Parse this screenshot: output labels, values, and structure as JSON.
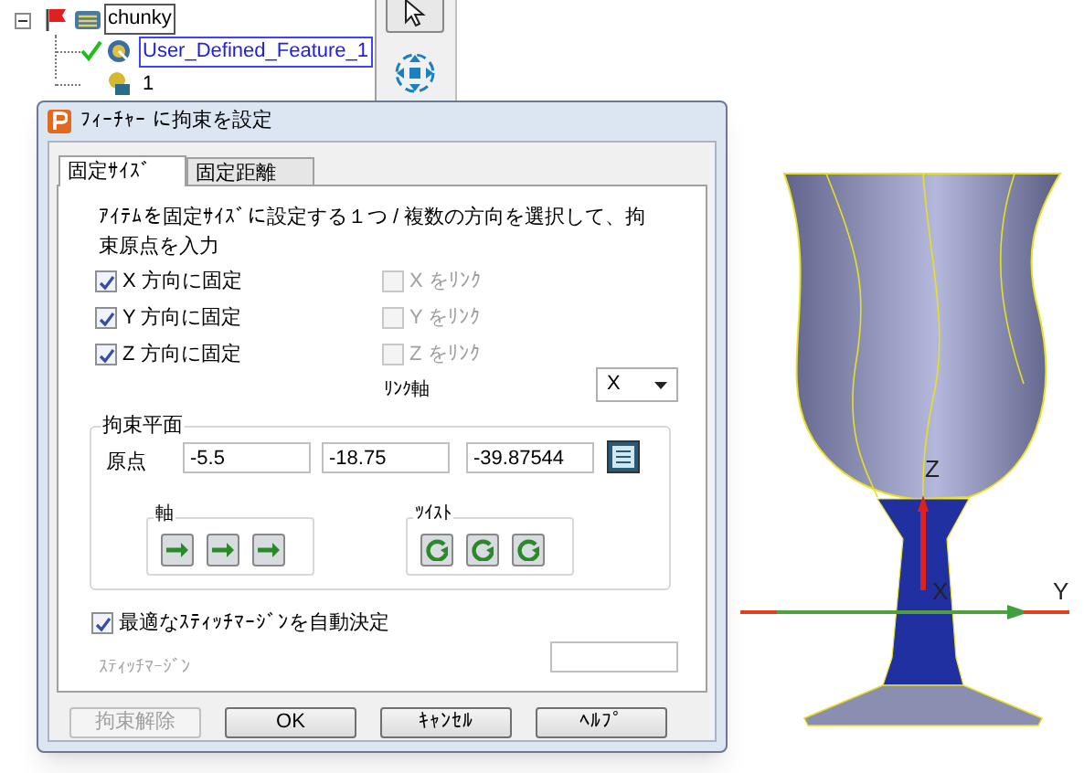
{
  "tree": {
    "label": "chunky",
    "expanded": true,
    "children": [
      {
        "label": "User_Defined_Feature_1",
        "checked": true,
        "selected": true
      },
      {
        "label": "1",
        "checked": false,
        "selected": false
      }
    ]
  },
  "dialog": {
    "title": "ﾌｨｰﾁｬｰ に拘束を設定",
    "tabs": [
      {
        "label": "固定ｻｲｽﾞ",
        "selected": true
      },
      {
        "label": "固定距離",
        "selected": false
      }
    ],
    "description": "ｱｲﾃﾑを固定ｻｲｽﾞに設定する１つ / 複数の方向を選択して、拘束原点を入力",
    "fix_checkboxes": [
      {
        "label": "X 方向に固定",
        "checked": true
      },
      {
        "label": "Y 方向に固定",
        "checked": true
      },
      {
        "label": "Z 方向に固定",
        "checked": true
      }
    ],
    "link_checkboxes": [
      {
        "label": "X をﾘﾝｸ",
        "checked": false,
        "disabled": true
      },
      {
        "label": "Y をﾘﾝｸ",
        "checked": false,
        "disabled": true
      },
      {
        "label": "Z をﾘﾝｸ",
        "checked": false,
        "disabled": true
      }
    ],
    "link_axis": {
      "label": "ﾘﾝｸ軸",
      "value": "X"
    },
    "constraint_plane": {
      "title": "拘束平面",
      "origin_label": "原点",
      "origin": [
        "-5.5",
        "-18.75",
        "-39.87544"
      ],
      "axis_group": {
        "title": "軸"
      },
      "twist_group": {
        "title": "ﾂｲｽﾄ"
      }
    },
    "auto_margin": {
      "label": "最適なｽﾃｨｯﾁﾏｰｼﾞﾝを自動決定",
      "checked": true
    },
    "stitch_margin": {
      "label": "ｽﾃｨｯﾁﾏｰｼﾞﾝ",
      "disabled": true
    },
    "buttons": [
      {
        "label": "拘束解除",
        "disabled": true
      },
      {
        "label": "OK",
        "disabled": false
      },
      {
        "label": "ｷｬﾝｾﾙ",
        "disabled": false
      },
      {
        "label": "ﾍﾙﾌﾟ",
        "disabled": false
      }
    ]
  },
  "viewport": {
    "axis_labels": [
      "Z",
      "X",
      "Y"
    ]
  }
}
